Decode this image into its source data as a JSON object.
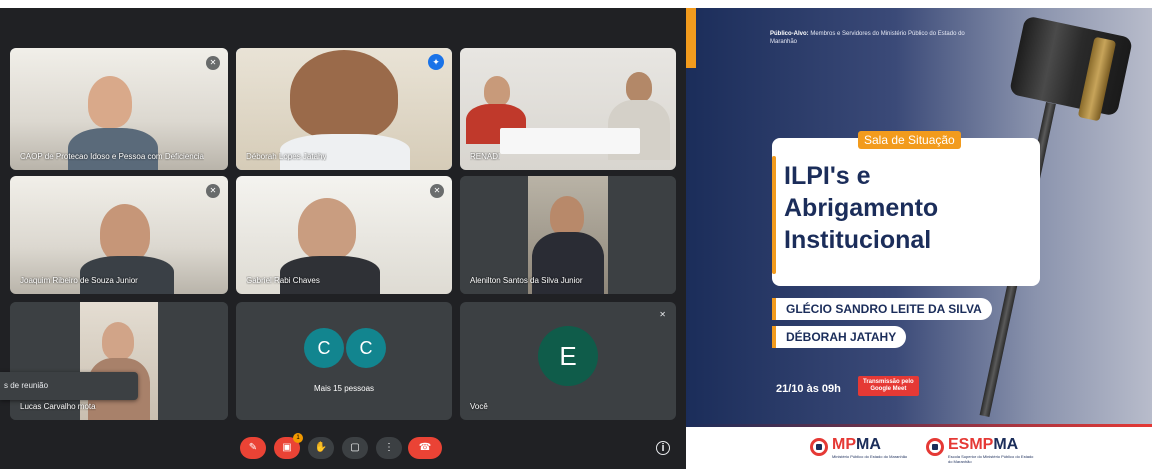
{
  "meet": {
    "tiles": [
      {
        "name": "CAOP de Protecao Idoso e Pessoa com Deficiencia"
      },
      {
        "name": "Déborah Lopes Jatahy"
      },
      {
        "name": "RENADI"
      },
      {
        "name": "Joaquim Ribeiro de Souza Junior"
      },
      {
        "name": "Gabriel Rabi Chaves"
      },
      {
        "name": "Alenilton Santos da Silva Junior"
      },
      {
        "name": "Lucas Carvalho mota"
      },
      {
        "name": "Mais 15 pessoas",
        "avatars": [
          "C",
          "C"
        ]
      },
      {
        "name": "Você",
        "avatar": "E"
      }
    ],
    "popup_text": "s de reunião",
    "controls": {
      "mic": "mic-off",
      "caption": "captions",
      "caption_badge": "1",
      "hand": "raise-hand",
      "present": "present",
      "more": "more",
      "end": "end-call",
      "info": "i"
    }
  },
  "poster": {
    "audience_label": "Público-Alvo:",
    "audience_text": "Membros e Servidores do Ministério Público do Estado do Maranhão",
    "tag": "Sala de Situação",
    "headline": [
      "ILPI's e",
      "Abrigamento",
      "Institucional"
    ],
    "speakers": [
      "GLÉCIO SANDRO LEITE DA SILVA",
      "DÉBORAH JATAHY"
    ],
    "date": "21/10 às 09h",
    "transmission": [
      "Transmissão pelo",
      "Google Meet"
    ],
    "logos": [
      {
        "a": "MP",
        "b": "MA",
        "sub": "Ministério Público do Estado do Maranhão"
      },
      {
        "a": "ESMP",
        "b": "MA",
        "sub": "Escola Superior do Ministério Público do Estado do Maranhão"
      }
    ]
  }
}
